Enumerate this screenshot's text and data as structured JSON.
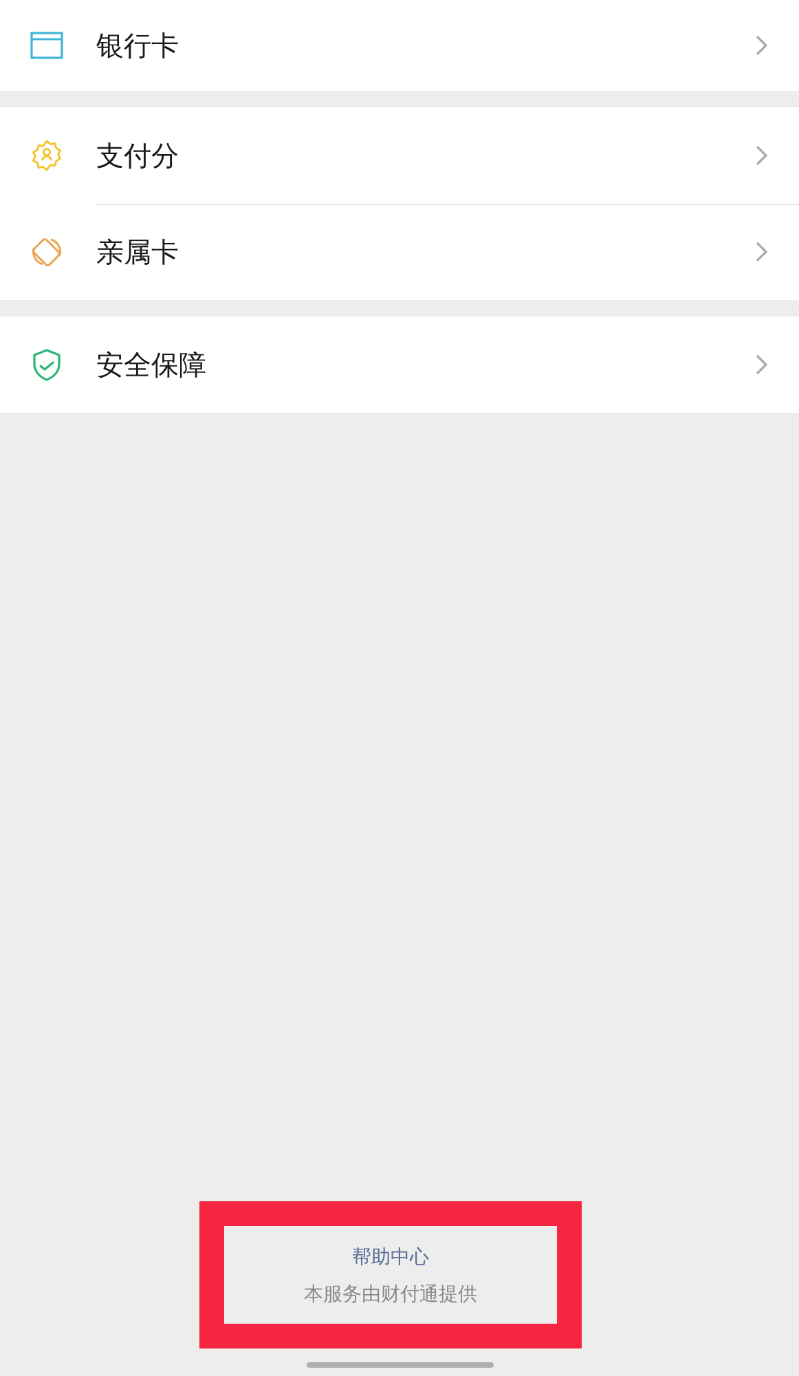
{
  "groups": [
    {
      "items": [
        {
          "label": "银行卡",
          "kind": "card"
        }
      ]
    },
    {
      "items": [
        {
          "label": "支付分",
          "kind": "score"
        },
        {
          "label": "亲属卡",
          "kind": "family"
        }
      ]
    },
    {
      "items": [
        {
          "label": "安全保障",
          "kind": "shield"
        }
      ]
    }
  ],
  "footer": {
    "link": "帮助中心",
    "note": "本服务由财付通提供"
  }
}
